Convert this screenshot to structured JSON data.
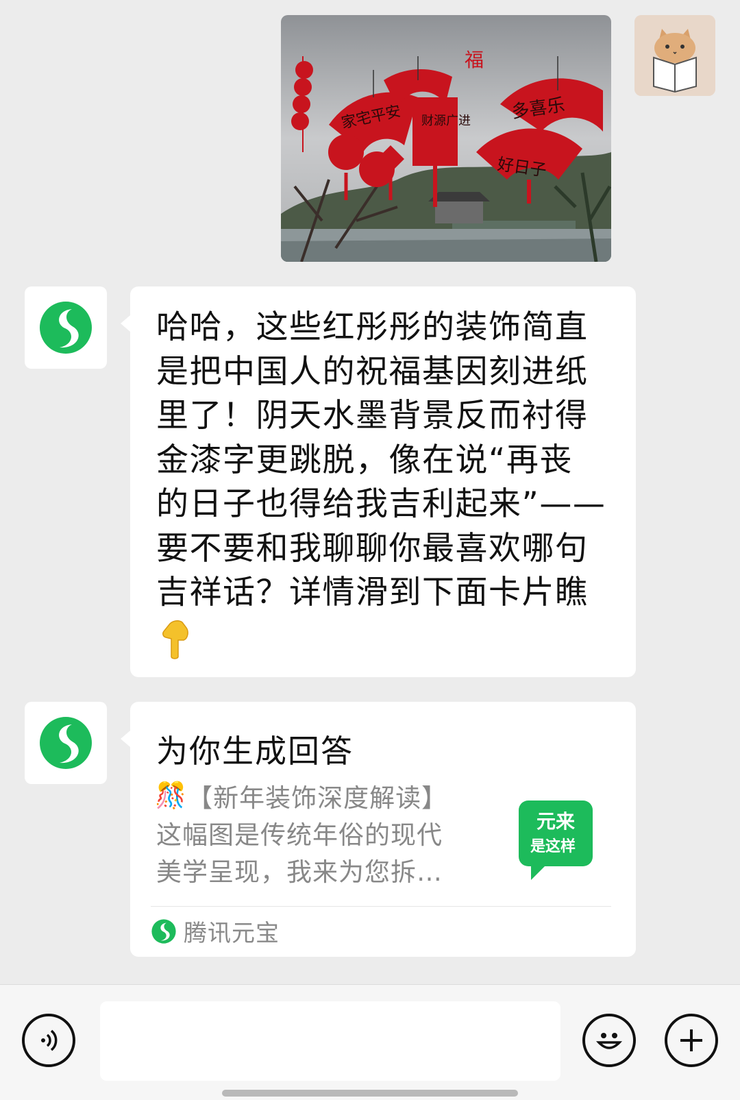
{
  "messages": {
    "user_image_alt": "新年装饰照片",
    "bot_reply": {
      "text": "哈哈，这些红彤彤的装饰简直\n是把中国人的祝福基因刻进纸\n里了！阴天水墨背景反而衬得\n金漆字更跳脱，像在说“再丧\n的日子也得给我吉利起来”——\n要不要和我聊聊你最喜欢哪句\n吉祥话？详情滑到下面卡片瞧",
      "emoji": "👇"
    },
    "card": {
      "title": "为你生成回答",
      "header": "【新年装饰深度解读】",
      "header_emoji": "🎊",
      "description": "这幅图是传统年俗的现代\n美学呈现，我来为您拆…",
      "thumb_line1": "元来",
      "thumb_line2": "是这样",
      "source": "腾讯元宝"
    }
  },
  "photo": {
    "fu": "福",
    "banners": [
      "家宅平安",
      "财源广进",
      "多喜乐",
      "好日子"
    ]
  },
  "input": {
    "placeholder": ""
  },
  "colors": {
    "brand_green": "#1dbb5b",
    "red": "#c8141e"
  }
}
